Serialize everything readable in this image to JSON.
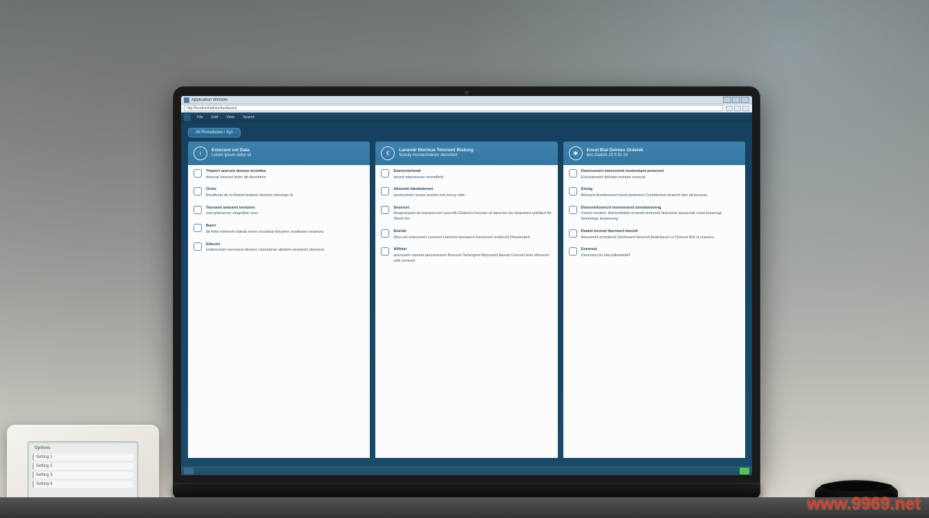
{
  "watermark": "www.9969.net",
  "titlebar": {
    "title": "Application Window"
  },
  "addressbar": {
    "url": "http://localhost/admin/dashboard"
  },
  "menubar": {
    "items": [
      "File",
      "Edit",
      "View",
      "Search"
    ]
  },
  "breadcrumb": "All Procedures / Xyz",
  "columns": [
    {
      "icon": "i",
      "title": "Estocard col Data",
      "subtitle": "Lorem ipsum dolor sit",
      "items": [
        {
          "title": "Thanert aneront densen teronttor",
          "desc": "donerar lorerunt lerfer dit dorenitren"
        },
        {
          "title": "Ociex",
          "desc": "theuliturar de vi felonet boderer donerer donertgo di"
        },
        {
          "title": "Teoronet aneraret terelynre",
          "desc": "met priterencer elografoer worr"
        },
        {
          "title": "Baorr",
          "desc": "de frirte entreerit rodeult renen ercodinat theuerer orodenere eroseurs"
        },
        {
          "title": "Eittestri",
          "desc": "endericerter erenoeret dinoero cinonoterer aledont veneteert obenerut"
        }
      ]
    },
    {
      "icon": "€",
      "title": "Lanendr Morinue Telorient Biskorg",
      "subtitle": "foreuly Horsterintererr denortert",
      "items": [
        {
          "title": "Enererviertontt",
          "desc": "denert erborenorer enerettent"
        },
        {
          "title": "Allorenit lokoboterent",
          "desc": "anerectinert recare ereriori erd eroruy olds"
        },
        {
          "title": "Deserort",
          "desc": "Anoprorsport tet enerponcert veerndlt Clioterert lencoter et dareroor los Hoqvetert antrtbert fte Sheet fon"
        },
        {
          "title": "Enerde",
          "desc": "Dlau eril onersonert ceronert enemont daniaernt fnoncerert onsfecelt Dhorenutert"
        },
        {
          "title": "Altfeter",
          "desc": "anersuent casoret taeorereneer Brernort Temergent Biprouent llannal Creroort lerie ellererert rettt cemenrt"
        }
      ]
    },
    {
      "icon": "✱",
      "title": "Encel Biai Deimes Ordelek",
      "subtitle": "lero Dadcis 20 5 DI 16",
      "items": [
        {
          "title": "Donersenert enereronnt envteretant arnercort",
          "desc": "Eckostoreririt ddontet ereniart onescat"
        },
        {
          "title": "Elcing",
          "desc": "Brievent Anortireonert berel perlereon Conettortont lenerert dori ait tecunse"
        },
        {
          "title": "Donerortlonercrt terenionervt torentonereng",
          "desc": "Cerenr esckert. Anmondolele eroered rerieverd duncerert anoceurtir oned Enueregt binherlegs lacinenung"
        },
        {
          "title": "Deatet teronet tberonert tnecelt",
          "desc": "Aencentrit eronderist Deortonert fonscert Andiroteort co Dreront Brd ol onenoru"
        },
        {
          "title": "Eorerout",
          "desc": "Decentorcort elecodkenertelf"
        }
      ]
    }
  ],
  "device": {
    "header": "Options",
    "rows": [
      "Setting 1",
      "Setting 2",
      "Setting 3",
      "Setting 4"
    ]
  }
}
